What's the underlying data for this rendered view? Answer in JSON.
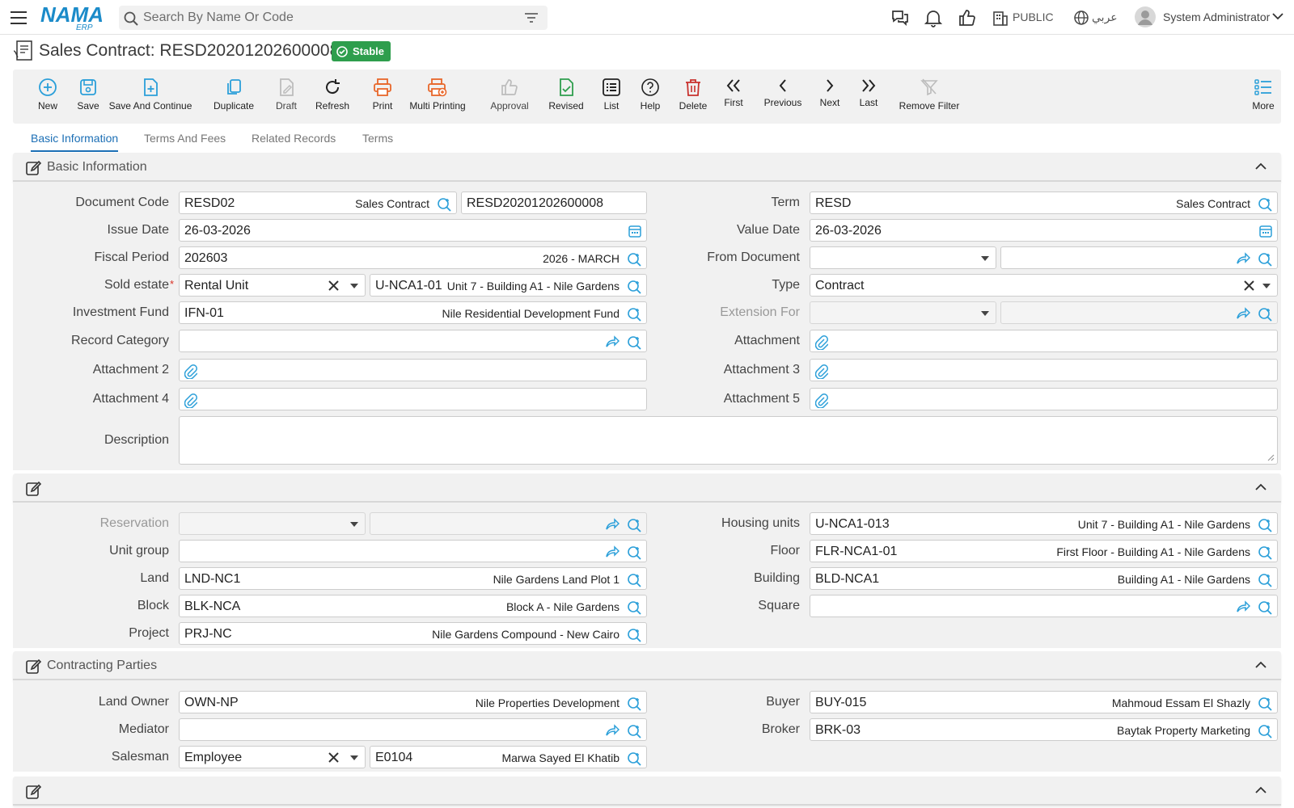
{
  "app": {
    "logo_text": "NAMA",
    "logo_sub": "ERP"
  },
  "search": {
    "placeholder": "Search By Name Or Code"
  },
  "topbar": {
    "branch": "PUBLIC",
    "language": "عربي",
    "user": "System Administrator"
  },
  "page": {
    "title": "Sales Contract: RESD20201202600008",
    "status": "Stable"
  },
  "toolbar": {
    "new": "New",
    "save": "Save",
    "save_continue": "Save And Continue",
    "duplicate": "Duplicate",
    "draft": "Draft",
    "refresh": "Refresh",
    "print": "Print",
    "multi_printing": "Multi Printing",
    "approval": "Approval",
    "revised": "Revised",
    "list": "List",
    "help": "Help",
    "delete": "Delete",
    "first": "First",
    "previous": "Previous",
    "next": "Next",
    "last": "Last",
    "remove_filter": "Remove Filter",
    "more": "More"
  },
  "tabs": [
    "Basic Information",
    "Terms And Fees",
    "Related Records",
    "Terms"
  ],
  "sections": {
    "basic": "Basic Information",
    "parties": "Contracting Parties"
  },
  "colors": {
    "accent": "#1c6fb5",
    "icon_blue": "#2b9fd9",
    "status_green": "#2e9e4d",
    "orange": "#e8672a",
    "red": "#c8302c"
  },
  "basic": {
    "document_code": {
      "label": "Document Code",
      "value": "RESD02",
      "tag": "Sales Contract",
      "code": "RESD20201202600008"
    },
    "term": {
      "label": "Term",
      "value": "RESD",
      "tag": "Sales Contract"
    },
    "issue_date": {
      "label": "Issue Date",
      "value": "26-03-2026"
    },
    "value_date": {
      "label": "Value Date",
      "value": "26-03-2026"
    },
    "fiscal_period": {
      "label": "Fiscal Period",
      "value": "202603",
      "tag": "2026 - MARCH"
    },
    "from_document": {
      "label": "From Document"
    },
    "sold_estate": {
      "label": "Sold estate",
      "type": "Rental Unit",
      "code": "U-NCA1-01",
      "tag": "Unit 7 - Building A1 - Nile Gardens"
    },
    "type": {
      "label": "Type",
      "value": "Contract"
    },
    "investment_fund": {
      "label": "Investment Fund",
      "value": "IFN-01",
      "tag": "Nile Residential Development Fund"
    },
    "extension_for": {
      "label": "Extension For"
    },
    "record_category": {
      "label": "Record Category"
    },
    "attachment": {
      "label": "Attachment"
    },
    "attachment2": {
      "label": "Attachment 2"
    },
    "attachment3": {
      "label": "Attachment 3"
    },
    "attachment4": {
      "label": "Attachment 4"
    },
    "attachment5": {
      "label": "Attachment 5"
    },
    "description": {
      "label": "Description"
    }
  },
  "unit": {
    "reservation": {
      "label": "Reservation"
    },
    "housing_units": {
      "label": "Housing units",
      "value": "U-NCA1-013",
      "tag": "Unit 7 - Building A1 - Nile Gardens"
    },
    "unit_group": {
      "label": "Unit group"
    },
    "floor": {
      "label": "Floor",
      "value": "FLR-NCA1-01",
      "tag": "First Floor - Building A1 - Nile Gardens"
    },
    "land": {
      "label": "Land",
      "value": "LND-NC1",
      "tag": "Nile Gardens Land Plot 1"
    },
    "building": {
      "label": "Building",
      "value": "BLD-NCA1",
      "tag": "Building A1 - Nile Gardens"
    },
    "block": {
      "label": "Block",
      "value": "BLK-NCA",
      "tag": "Block A - Nile Gardens"
    },
    "square": {
      "label": "Square"
    },
    "project": {
      "label": "Project",
      "value": "PRJ-NC",
      "tag": "Nile Gardens Compound - New Cairo"
    }
  },
  "parties": {
    "land_owner": {
      "label": "Land Owner",
      "value": "OWN-NP",
      "tag": "Nile Properties Development"
    },
    "buyer": {
      "label": "Buyer",
      "value": "BUY-015",
      "tag": "Mahmoud Essam El Shazly"
    },
    "mediator": {
      "label": "Mediator"
    },
    "broker": {
      "label": "Broker",
      "value": "BRK-03",
      "tag": "Baytak Property Marketing"
    },
    "salesman": {
      "label": "Salesman",
      "type": "Employee",
      "value": "E0104",
      "tag": "Marwa Sayed El Khatib"
    }
  }
}
